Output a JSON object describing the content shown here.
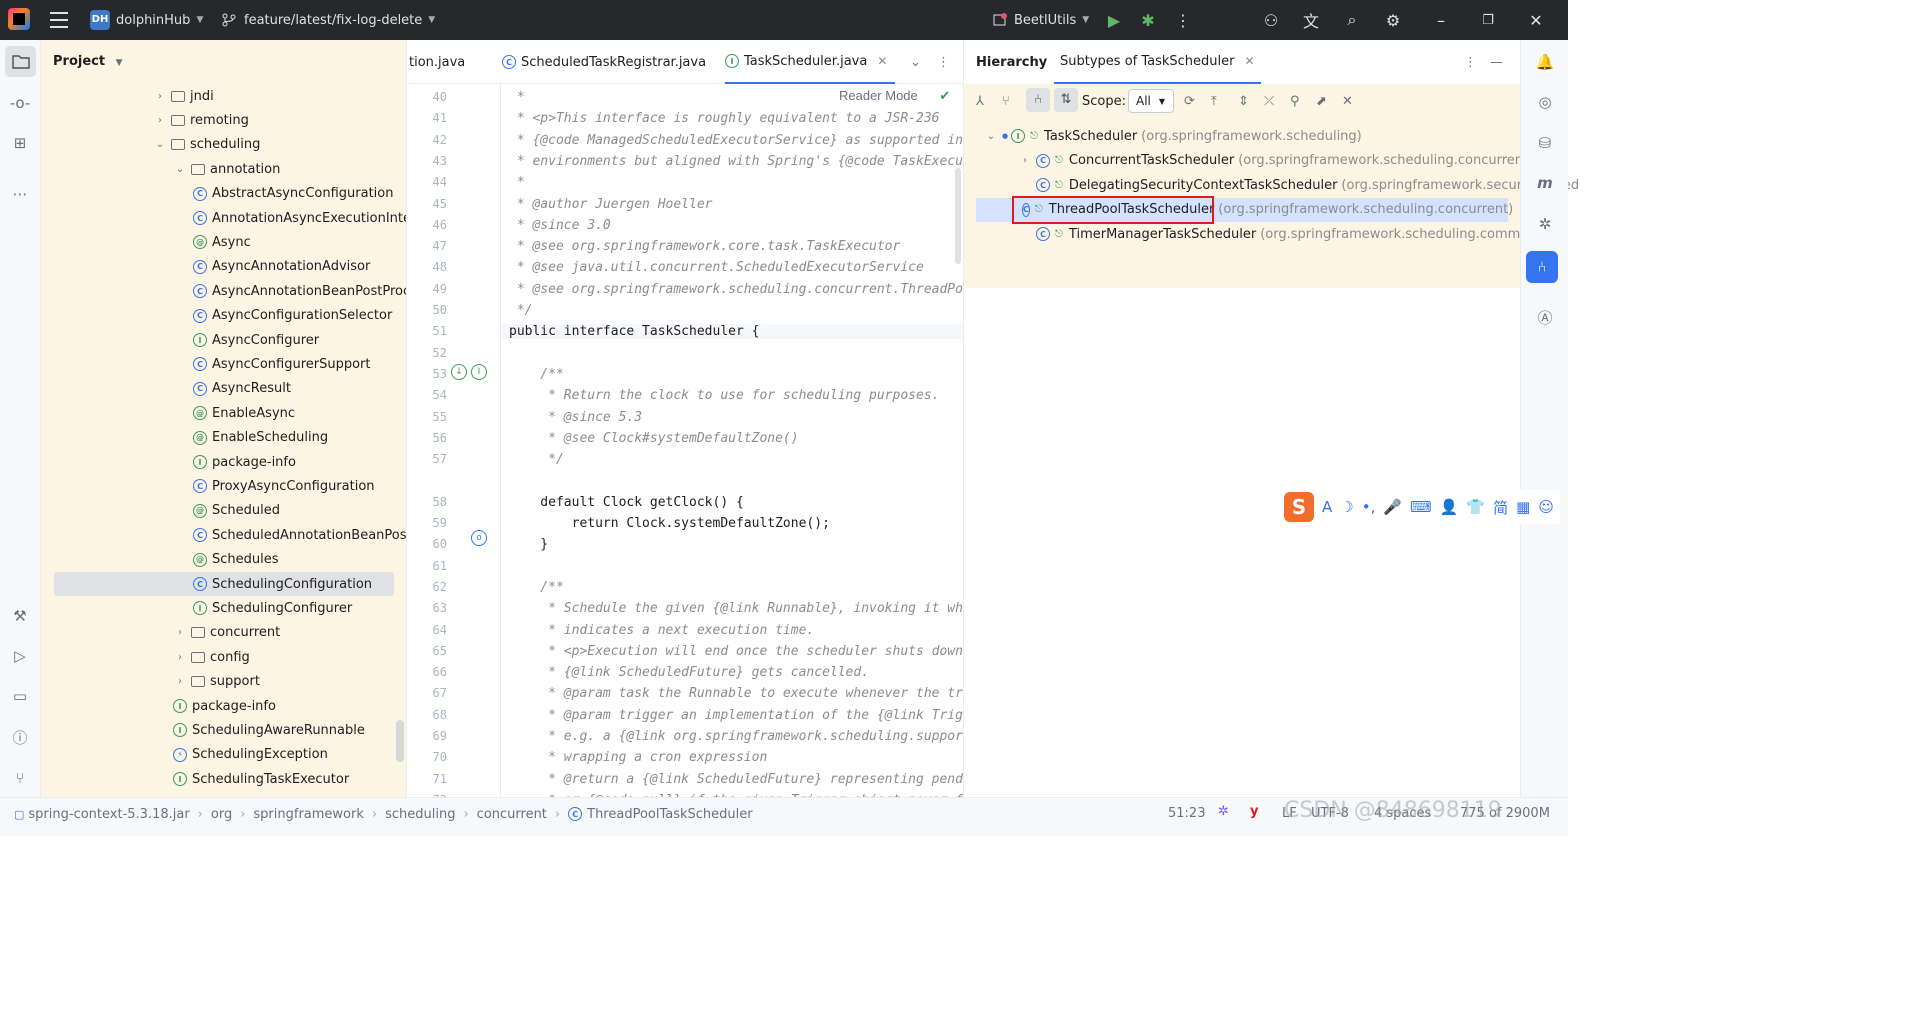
{
  "titlebar": {
    "project_badge": "DH",
    "project_name": "dolphinHub",
    "branch": "feature/latest/fix-log-delete",
    "run_config": "BeetlUtils"
  },
  "project_panel": {
    "title": "Project",
    "items": [
      {
        "label": "jndi",
        "kind": "folder",
        "indent": 1,
        "expand": "closed"
      },
      {
        "label": "remoting",
        "kind": "folder",
        "indent": 1,
        "expand": "closed"
      },
      {
        "label": "scheduling",
        "kind": "folder",
        "indent": 1,
        "expand": "open"
      },
      {
        "label": "annotation",
        "kind": "folder",
        "indent": 2,
        "expand": "open"
      },
      {
        "label": "AbstractAsyncConfiguration",
        "kind": "C",
        "indent": 3
      },
      {
        "label": "AnnotationAsyncExecutionInterce",
        "kind": "C",
        "indent": 3
      },
      {
        "label": "Async",
        "kind": "@",
        "indent": 3
      },
      {
        "label": "AsyncAnnotationAdvisor",
        "kind": "C",
        "indent": 3
      },
      {
        "label": "AsyncAnnotationBeanPostProces",
        "kind": "C",
        "indent": 3
      },
      {
        "label": "AsyncConfigurationSelector",
        "kind": "C",
        "indent": 3
      },
      {
        "label": "AsyncConfigurer",
        "kind": "I",
        "indent": 3
      },
      {
        "label": "AsyncConfigurerSupport",
        "kind": "C",
        "indent": 3
      },
      {
        "label": "AsyncResult",
        "kind": "C",
        "indent": 3
      },
      {
        "label": "EnableAsync",
        "kind": "@",
        "indent": 3
      },
      {
        "label": "EnableScheduling",
        "kind": "@",
        "indent": 3
      },
      {
        "label": "package-info",
        "kind": "I",
        "indent": 3
      },
      {
        "label": "ProxyAsyncConfiguration",
        "kind": "C",
        "indent": 3
      },
      {
        "label": "Scheduled",
        "kind": "@",
        "indent": 3
      },
      {
        "label": "ScheduledAnnotationBeanPostPr",
        "kind": "C",
        "indent": 3
      },
      {
        "label": "Schedules",
        "kind": "@",
        "indent": 3
      },
      {
        "label": "SchedulingConfiguration",
        "kind": "C",
        "indent": 3,
        "selected": true
      },
      {
        "label": "SchedulingConfigurer",
        "kind": "I",
        "indent": 3
      },
      {
        "label": "concurrent",
        "kind": "folder",
        "indent": 2,
        "expand": "closed"
      },
      {
        "label": "config",
        "kind": "folder",
        "indent": 2,
        "expand": "closed"
      },
      {
        "label": "support",
        "kind": "folder",
        "indent": 2,
        "expand": "closed"
      },
      {
        "label": "package-info",
        "kind": "I",
        "indent": 2
      },
      {
        "label": "SchedulingAwareRunnable",
        "kind": "I",
        "indent": 2
      },
      {
        "label": "SchedulingException",
        "kind": "E",
        "indent": 2
      },
      {
        "label": "SchedulingTaskExecutor",
        "kind": "I",
        "indent": 2
      }
    ]
  },
  "editor": {
    "tabs": [
      {
        "label": "tion.java",
        "active": false
      },
      {
        "label": "ScheduledTaskRegistrar.java",
        "active": false
      },
      {
        "label": "TaskScheduler.java",
        "active": true
      }
    ],
    "reader_mode": "Reader Mode",
    "lines": [
      {
        "n": "40",
        "t": " *"
      },
      {
        "n": "41",
        "t": " * <p>This interface is roughly equivalent to a JSR-236"
      },
      {
        "n": "42",
        "t": " * {@code ManagedScheduledExecutorService} as supported in Java"
      },
      {
        "n": "43",
        "t": " * environments but aligned with Spring's {@code TaskExecutor}"
      },
      {
        "n": "44",
        "t": " *"
      },
      {
        "n": "45",
        "t": " * @author Juergen Hoeller"
      },
      {
        "n": "46",
        "t": " * @since 3.0"
      },
      {
        "n": "47",
        "t": " * @see org.springframework.core.task.TaskExecutor"
      },
      {
        "n": "48",
        "t": " * @see java.util.concurrent.ScheduledExecutorService"
      },
      {
        "n": "49",
        "t": " * @see org.springframework.scheduling.concurrent.ThreadPoolTas"
      },
      {
        "n": "50",
        "t": " */"
      },
      {
        "n": "51",
        "t": "public interface TaskScheduler {"
      },
      {
        "n": "52",
        "t": ""
      },
      {
        "n": "53",
        "t": "    /**"
      },
      {
        "n": "54",
        "t": "     * Return the clock to use for scheduling purposes."
      },
      {
        "n": "55",
        "t": "     * @since 5.3"
      },
      {
        "n": "56",
        "t": "     * @see Clock#systemDefaultZone()"
      },
      {
        "n": "57",
        "t": "     */"
      },
      {
        "n": "",
        "t": ""
      },
      {
        "n": "58",
        "t": "    default Clock getClock() {"
      },
      {
        "n": "59",
        "t": "        return Clock.systemDefaultZone();"
      },
      {
        "n": "60",
        "t": "    }"
      },
      {
        "n": "61",
        "t": ""
      },
      {
        "n": "62",
        "t": "    /**"
      },
      {
        "n": "63",
        "t": "     * Schedule the given {@link Runnable}, invoking it wheneve"
      },
      {
        "n": "64",
        "t": "     * indicates a next execution time."
      },
      {
        "n": "65",
        "t": "     * <p>Execution will end once the scheduler shuts down or t"
      },
      {
        "n": "66",
        "t": "     * {@link ScheduledFuture} gets cancelled."
      },
      {
        "n": "67",
        "t": "     * @param task the Runnable to execute whenever the trigger"
      },
      {
        "n": "68",
        "t": "     * @param trigger an implementation of the {@link Trigger}"
      },
      {
        "n": "69",
        "t": "     * e.g. a {@link org.springframework.scheduling.support.Cro"
      },
      {
        "n": "70",
        "t": "     * wrapping a cron expression"
      },
      {
        "n": "71",
        "t": "     * @return a {@link ScheduledFuture} representing pending c"
      },
      {
        "n": "72",
        "t": "     * or {@code null} if the given Trigger object never fires"
      }
    ]
  },
  "hierarchy": {
    "title": "Hierarchy",
    "tab": "Subtypes of TaskScheduler",
    "scope_label": "Scope:",
    "scope_value": "All",
    "rows": [
      {
        "kind": "I",
        "name": "TaskScheduler",
        "pkg": "(org.springframework.scheduling)",
        "indent": 0,
        "expand": "open"
      },
      {
        "kind": "C",
        "name": "ConcurrentTaskScheduler",
        "pkg": "(org.springframework.scheduling.concurrent)",
        "indent": 1,
        "expand": "closed"
      },
      {
        "kind": "C",
        "name": "DelegatingSecurityContextTaskScheduler",
        "pkg": "(org.springframework.security.sched",
        "indent": 1
      },
      {
        "kind": "C",
        "name": "ThreadPoolTaskScheduler",
        "pkg": "(org.springframework.scheduling.concurrent)",
        "indent": 1,
        "selected": true
      },
      {
        "kind": "C",
        "name": "TimerManagerTaskScheduler",
        "pkg": "(org.springframework.scheduling.commonj)",
        "indent": 1
      }
    ]
  },
  "statusbar": {
    "breadcrumbs": [
      "spring-context-5.3.18.jar",
      "org",
      "springframework",
      "scheduling",
      "concurrent",
      "ThreadPoolTaskScheduler"
    ],
    "position": "51:23",
    "line_ending": "LF",
    "encoding": "UTF-8",
    "indent": "4 spaces",
    "memory": "775 of 2900M",
    "watermark": "CSDN @848698119"
  },
  "ime_toolbar": {
    "logo": "S",
    "items": [
      "A",
      "☽",
      "•,",
      "🎤",
      "⌨",
      "👤",
      "👕",
      "简",
      "▦",
      "☺"
    ]
  }
}
